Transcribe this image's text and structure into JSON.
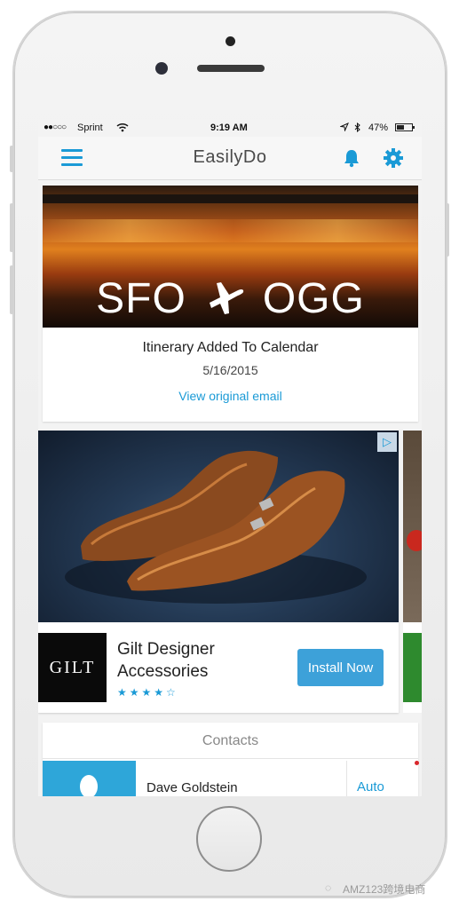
{
  "status_bar": {
    "signal": "●●○○○",
    "carrier": "Sprint",
    "wifi_icon": "wifi-icon",
    "time": "9:19 AM",
    "battery_percent": "47%"
  },
  "nav": {
    "title": "EasilyDo",
    "accent_color": "#1a9ad6"
  },
  "itinerary_card": {
    "origin": "SFO",
    "destination": "OGG",
    "title": "Itinerary Added To Calendar",
    "date": "5/16/2015",
    "link": "View original email"
  },
  "ad_card": {
    "brand_logo": "GILT",
    "title": "Gilt Designer Accessories",
    "rating": 4,
    "stars": "★★★★☆",
    "button": "Install Now",
    "button_color": "#3da1d9"
  },
  "contacts_card": {
    "heading": "Contacts",
    "contact_name": "Dave Goldstein",
    "action": "Auto"
  },
  "watermark": {
    "text": "AMZ123跨境电商"
  }
}
